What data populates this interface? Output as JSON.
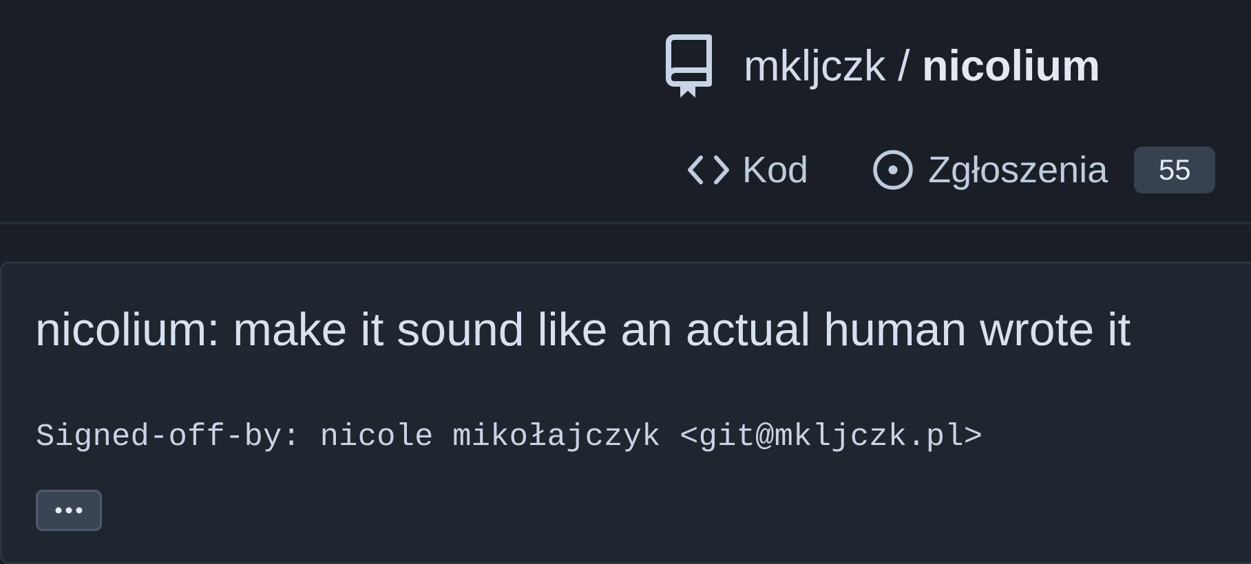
{
  "header": {
    "repo_icon": "repo-book-icon",
    "owner": "mkljczk",
    "separator": "/",
    "repo": "nicolium",
    "tabs": [
      {
        "label": "Kod",
        "icon": "code-icon"
      },
      {
        "label": "Zgłoszenia",
        "icon": "issue-opened-icon",
        "count": "55"
      }
    ]
  },
  "commit": {
    "title": "nicolium: make it sound like an actual human wrote it",
    "body": "Signed-off-by: nicole mikołajczyk <git@mkljczk.pl>",
    "expand_icon": "ellipsis-icon"
  },
  "colors": {
    "background": "#1a1f27",
    "card_background": "#20262f",
    "text": "#c9d4e6",
    "badge_background": "#38414f"
  }
}
